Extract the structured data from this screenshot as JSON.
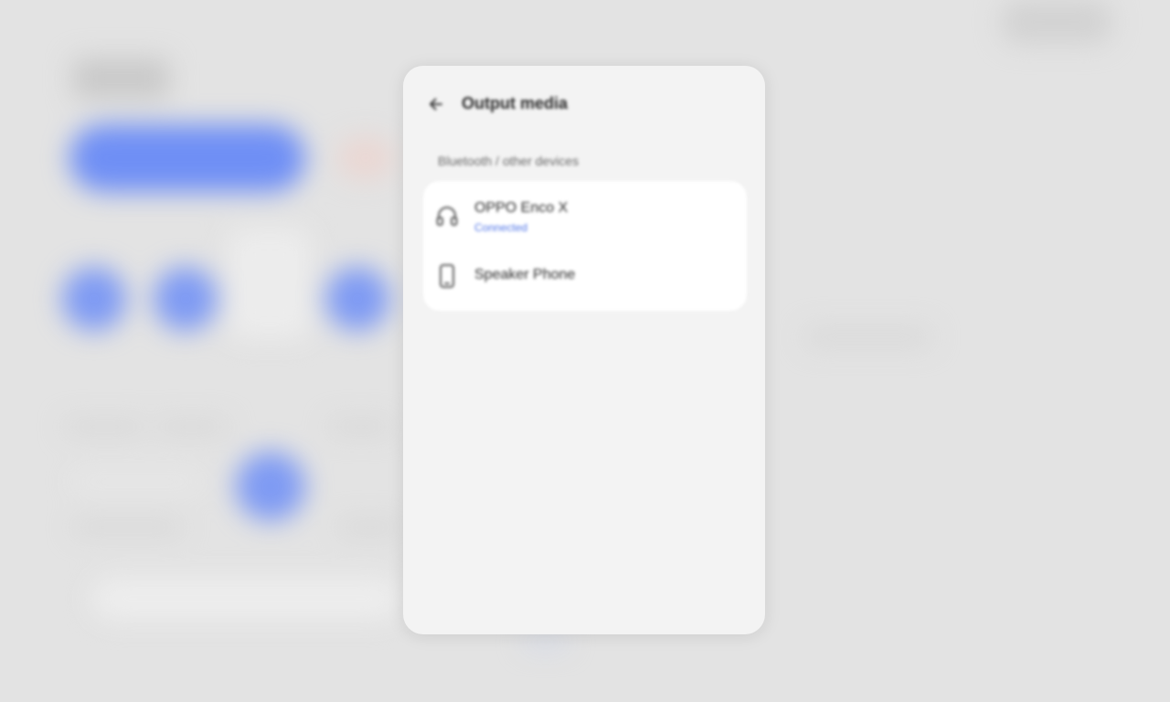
{
  "dialog": {
    "title": "Output media",
    "section_label": "Bluetooth / other devices",
    "devices": [
      {
        "name": "OPPO Enco X",
        "status": "Connected",
        "icon": "headphones-icon"
      },
      {
        "name": "Speaker Phone",
        "status": "",
        "icon": "phone-icon"
      }
    ]
  },
  "colors": {
    "accent": "#4f74e6",
    "dialog_bg": "#f3f3f3",
    "card_bg": "#ffffff",
    "page_bg": "#e3e3e3",
    "background_accent": "#6f8ff5"
  }
}
